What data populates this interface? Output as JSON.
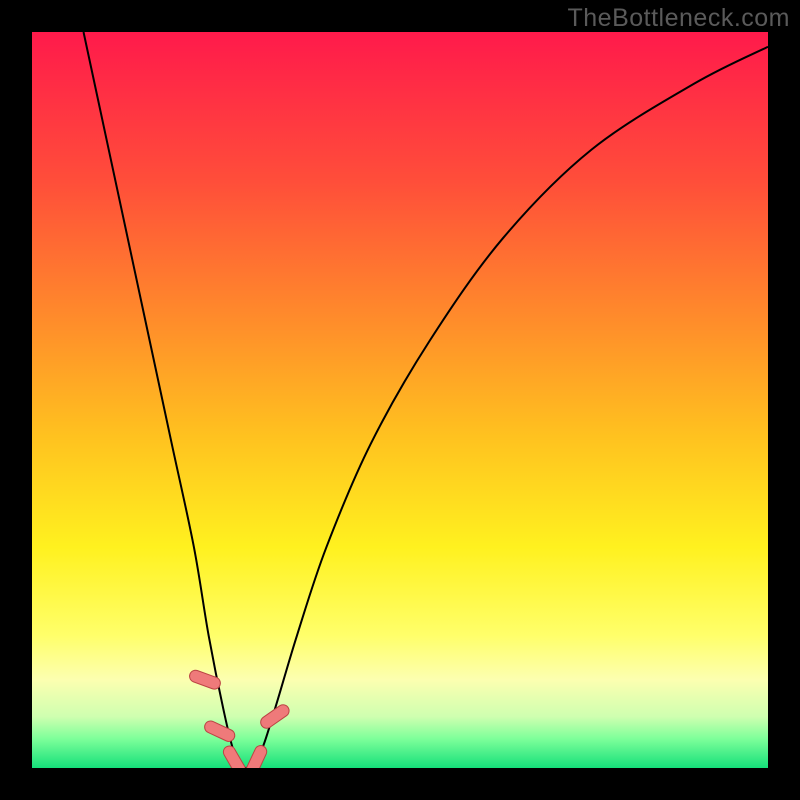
{
  "watermark": "TheBottleneck.com",
  "chart_data": {
    "type": "line",
    "title": "",
    "xlabel": "",
    "ylabel": "",
    "xlim": [
      0,
      100
    ],
    "ylim": [
      0,
      100
    ],
    "background": {
      "type": "vertical-gradient",
      "stops": [
        {
          "offset": 0,
          "color": "#ff1a4b"
        },
        {
          "offset": 0.2,
          "color": "#ff4d3a"
        },
        {
          "offset": 0.4,
          "color": "#ff8f2a"
        },
        {
          "offset": 0.55,
          "color": "#ffc21f"
        },
        {
          "offset": 0.7,
          "color": "#fff11f"
        },
        {
          "offset": 0.82,
          "color": "#ffff6a"
        },
        {
          "offset": 0.88,
          "color": "#fcffb0"
        },
        {
          "offset": 0.93,
          "color": "#cfffb0"
        },
        {
          "offset": 0.96,
          "color": "#7eff9a"
        },
        {
          "offset": 1.0,
          "color": "#15e07a"
        }
      ]
    },
    "series": [
      {
        "name": "curve",
        "color": "#000000",
        "width": 2,
        "x": [
          7,
          10,
          13,
          16,
          19,
          22,
          24,
          26,
          27.5,
          29,
          31,
          33,
          36,
          40,
          46,
          54,
          64,
          76,
          90,
          100
        ],
        "values": [
          100,
          86,
          72,
          58,
          44,
          30,
          18,
          8,
          2,
          0,
          2,
          8,
          18,
          30,
          44,
          58,
          72,
          84,
          93,
          98
        ]
      }
    ],
    "markers": [
      {
        "x": 23.5,
        "y": 12,
        "angle": -70
      },
      {
        "x": 25.5,
        "y": 5,
        "angle": -65
      },
      {
        "x": 27.5,
        "y": 1,
        "angle": -30
      },
      {
        "x": 30.5,
        "y": 1,
        "angle": 25
      },
      {
        "x": 33.0,
        "y": 7,
        "angle": 55
      }
    ],
    "marker_style": {
      "fill": "#ef7a7a",
      "stroke": "#b44",
      "rx": 6,
      "width": 12,
      "height": 32
    }
  }
}
